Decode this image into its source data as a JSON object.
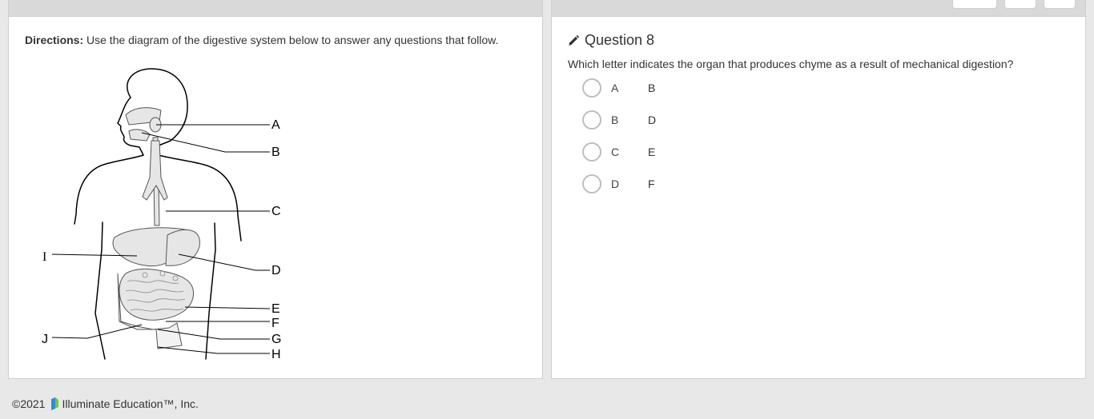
{
  "directions": {
    "label": "Directions:",
    "text": " Use the diagram of the digestive system below to answer any questions that follow."
  },
  "diagram": {
    "labels": [
      "A",
      "B",
      "C",
      "D",
      "E",
      "F",
      "G",
      "H",
      "I",
      "J"
    ]
  },
  "question": {
    "icon": "pencil-icon",
    "title": "Question 8",
    "text": "Which letter indicates the organ that produces chyme as a result of mechanical digestion?",
    "choices": [
      {
        "letter": "A",
        "value": "B"
      },
      {
        "letter": "B",
        "value": "D"
      },
      {
        "letter": "C",
        "value": "E"
      },
      {
        "letter": "D",
        "value": "F"
      }
    ]
  },
  "footer": {
    "copyright": "©2021",
    "company": "Illuminate Education™, Inc.",
    "logo_icon": "illuminate-logo-icon"
  }
}
